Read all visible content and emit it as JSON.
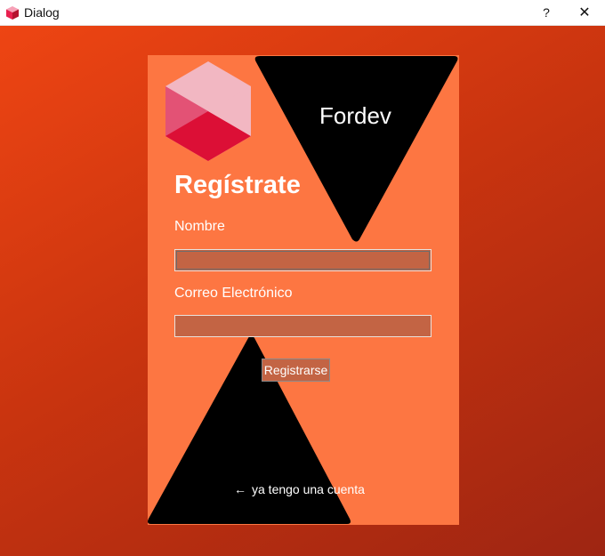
{
  "window": {
    "title": "Dialog",
    "help_label": "?",
    "close_label": "✕"
  },
  "colors": {
    "background_start": "#ee4513",
    "background_end": "#9e2512",
    "card": "#fd7642",
    "triangles": "#000000",
    "field_fill": "#c36444",
    "text": "#ffffff"
  },
  "brand": {
    "name": "Fordev",
    "logo_icon": "hexagon-cube-logo"
  },
  "form": {
    "heading": "Regístrate",
    "name_label": "Nombre",
    "name_value": "",
    "email_label": "Correo Electrónico",
    "email_value": "",
    "submit_label": "Registrarse"
  },
  "footer": {
    "link_icon": "arrow-left-icon",
    "link_label": "ya tengo una cuenta"
  }
}
